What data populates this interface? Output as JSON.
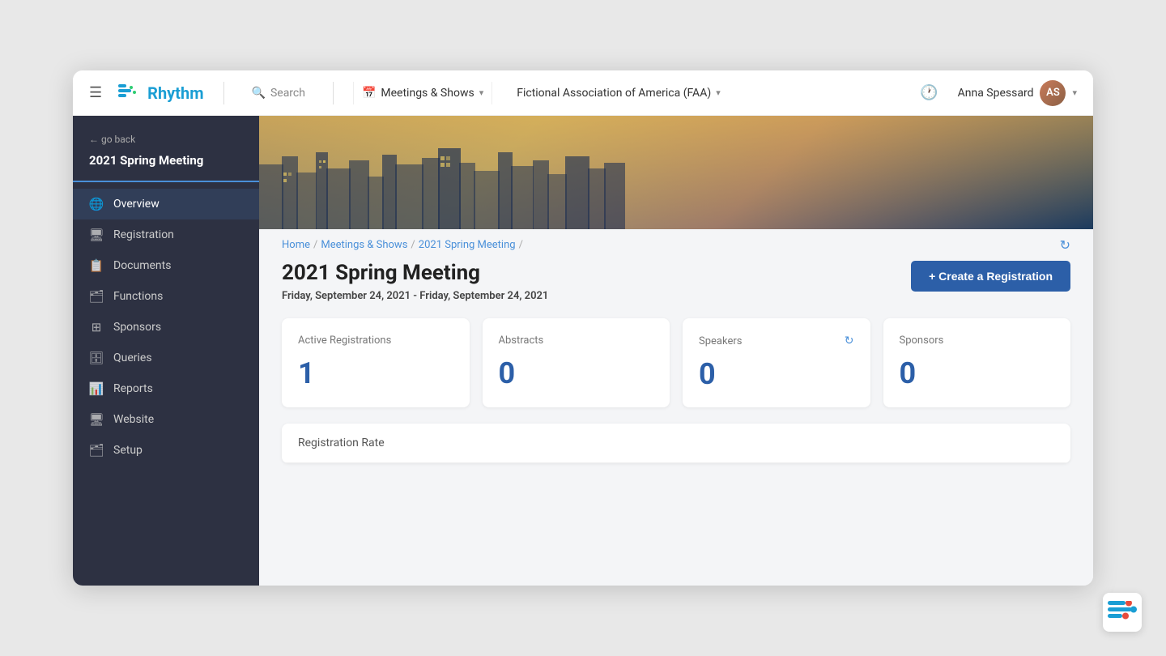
{
  "app": {
    "logo_text": "Rhythm",
    "hamburger_label": "☰"
  },
  "topnav": {
    "search_label": "Search",
    "meetings_label": "Meetings & Shows",
    "org_label": "Fictional Association of America (FAA)",
    "user_name": "Anna Spessard",
    "user_initials": "AS"
  },
  "sidebar": {
    "go_back_label": "← go back",
    "meeting_title": "2021 Spring Meeting",
    "items": [
      {
        "id": "overview",
        "label": "Overview",
        "icon": "🌐",
        "active": true
      },
      {
        "id": "registration",
        "label": "Registration",
        "icon": "🖥",
        "active": false
      },
      {
        "id": "documents",
        "label": "Documents",
        "icon": "📋",
        "active": false
      },
      {
        "id": "functions",
        "label": "Functions",
        "icon": "🗂",
        "active": false
      },
      {
        "id": "sponsors",
        "label": "Sponsors",
        "icon": "⊞",
        "active": false
      },
      {
        "id": "queries",
        "label": "Queries",
        "icon": "🗄",
        "active": false
      },
      {
        "id": "reports",
        "label": "Reports",
        "icon": "📊",
        "active": false
      },
      {
        "id": "website",
        "label": "Website",
        "icon": "🖥",
        "active": false
      },
      {
        "id": "setup",
        "label": "Setup",
        "icon": "🗂",
        "active": false
      }
    ]
  },
  "breadcrumb": {
    "items": [
      "Home",
      "Meetings & Shows",
      "2021 Spring Meeting",
      ""
    ]
  },
  "meeting": {
    "title": "2021 Spring Meeting",
    "date_range": "Friday, September 24, 2021 - Friday, September 24, 2021",
    "create_btn_label": "+ Create a Registration"
  },
  "stats": [
    {
      "id": "active-registrations",
      "label": "Active Registrations",
      "value": "1",
      "has_refresh": false
    },
    {
      "id": "abstracts",
      "label": "Abstracts",
      "value": "0",
      "has_refresh": false
    },
    {
      "id": "speakers",
      "label": "Speakers",
      "value": "0",
      "has_refresh": true
    },
    {
      "id": "sponsors",
      "label": "Sponsors",
      "value": "0",
      "has_refresh": false
    }
  ],
  "rate_section": {
    "label": "Registration Rate"
  }
}
